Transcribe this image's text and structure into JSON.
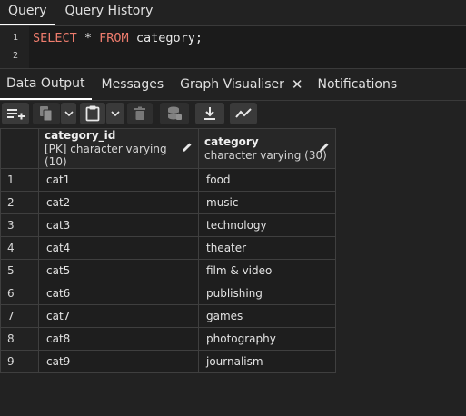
{
  "top_tabs": [
    {
      "label": "Query",
      "active": true
    },
    {
      "label": "Query History",
      "active": false
    }
  ],
  "editor": {
    "line_numbers": [
      "1",
      "2"
    ],
    "tokens": {
      "select": "SELECT",
      "star": " * ",
      "from": "FROM",
      "rest": " category;"
    }
  },
  "bottom_tabs": [
    {
      "label": "Data Output",
      "active": true
    },
    {
      "label": "Messages",
      "active": false
    },
    {
      "label": "Graph Visualiser",
      "active": false,
      "closable": true,
      "close_glyph": "✕"
    },
    {
      "label": "Notifications",
      "active": false
    }
  ],
  "toolbar": {
    "buttons": [
      "add-row-icon",
      "copy-icon",
      "paste-icon",
      "delete-icon",
      "save-data-icon",
      "download-icon",
      "graph-icon"
    ]
  },
  "grid": {
    "columns": [
      {
        "name": "category_id",
        "type": "[PK] character varying (10)"
      },
      {
        "name": "category",
        "type": "character varying (30)"
      }
    ],
    "rows": [
      {
        "num": "1",
        "id": "cat1",
        "category": "food"
      },
      {
        "num": "2",
        "id": "cat2",
        "category": "music"
      },
      {
        "num": "3",
        "id": "cat3",
        "category": "technology"
      },
      {
        "num": "4",
        "id": "cat4",
        "category": "theater"
      },
      {
        "num": "5",
        "id": "cat5",
        "category": "film & video"
      },
      {
        "num": "6",
        "id": "cat6",
        "category": "publishing"
      },
      {
        "num": "7",
        "id": "cat7",
        "category": "games"
      },
      {
        "num": "8",
        "id": "cat8",
        "category": "photography"
      },
      {
        "num": "9",
        "id": "cat9",
        "category": "journalism"
      }
    ]
  },
  "colors": {
    "background": "#222222",
    "editor_bg": "#1b1b1b",
    "keyword": "#ee7c6d",
    "button_bg": "#3a3a3a",
    "border": "#3f3f3f"
  }
}
